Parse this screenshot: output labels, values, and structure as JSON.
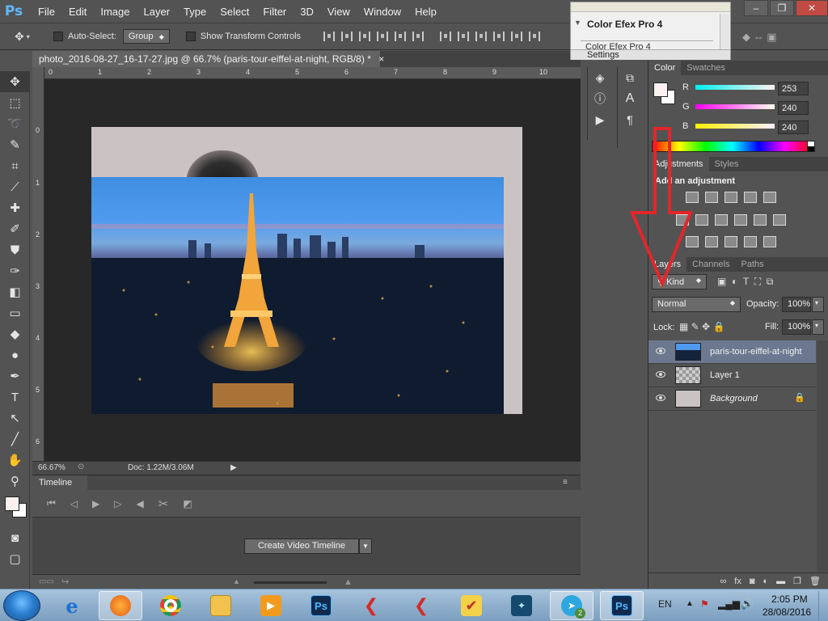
{
  "app": {
    "logo": "Ps"
  },
  "menu": [
    "File",
    "Edit",
    "Image",
    "Layer",
    "Type",
    "Select",
    "Filter",
    "3D",
    "View",
    "Window",
    "Help"
  ],
  "window_controls": {
    "minimize": "–",
    "restore": "❐",
    "close": "✕"
  },
  "options_bar": {
    "auto_select_label": "Auto-Select:",
    "auto_select_value": "Group",
    "show_transform_label": "Show Transform Controls"
  },
  "document": {
    "tab_title": "photo_2016-08-27_16-17-27.jpg @ 66.7% (paris-tour-eiffel-at-night, RGB/8) *",
    "tab_close": "×",
    "ruler_top": [
      "0",
      "1",
      "2",
      "3",
      "4",
      "5",
      "6",
      "7",
      "8",
      "9",
      "10"
    ],
    "ruler_left": [
      "0",
      "1",
      "2",
      "3",
      "4",
      "5",
      "6"
    ],
    "zoom": "66.67%",
    "doc_size": "Doc: 1.22M/3.06M"
  },
  "timeline": {
    "tab_label": "Timeline",
    "create_button": "Create Video Timeline"
  },
  "color_efex": {
    "title": "Color Efex Pro 4",
    "item": "Color Efex Pro 4",
    "settings": "Settings"
  },
  "color_panel": {
    "tabs": [
      "Color",
      "Swatches"
    ],
    "r_label": "R",
    "g_label": "G",
    "b_label": "B",
    "r": "253",
    "g": "240",
    "b": "240",
    "foreground": "#fdf0f0"
  },
  "adjustments_panel": {
    "tabs": [
      "Adjustments",
      "Styles"
    ],
    "heading": "Add an adjustment"
  },
  "layers_panel": {
    "tabs": [
      "Layers",
      "Channels",
      "Paths"
    ],
    "filter_kind": "Kind",
    "blend_mode": "Normal",
    "opacity_label": "Opacity:",
    "opacity": "100%",
    "lock_label": "Lock:",
    "fill_label": "Fill:",
    "fill": "100%",
    "layers": [
      {
        "name": "paris-tour-eiffel-at-night",
        "selected": true
      },
      {
        "name": "Layer 1",
        "selected": false
      },
      {
        "name": "Background",
        "selected": false,
        "italic": true
      }
    ]
  },
  "taskbar": {
    "language": "EN",
    "time": "2:05 PM",
    "date": "28/08/2016",
    "telegram_badge": "2"
  },
  "colors": {
    "accent_arrow": "#e3262b",
    "selected_layer": "#6c7890"
  }
}
